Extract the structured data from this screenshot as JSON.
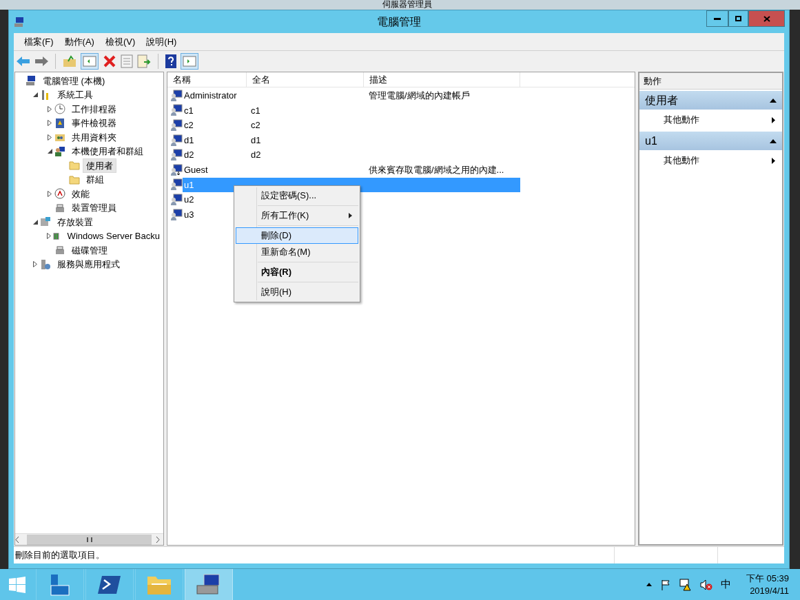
{
  "background_window": {
    "title": "伺服器管理員"
  },
  "window": {
    "title": "電腦管理"
  },
  "menu": [
    {
      "label": "檔案(F)"
    },
    {
      "label": "動作(A)"
    },
    {
      "label": "檢視(V)"
    },
    {
      "label": "說明(H)"
    }
  ],
  "tree": [
    {
      "label": "電腦管理 (本機)",
      "kind": "computer",
      "selected": false,
      "children": [
        {
          "label": "系統工具",
          "kind": "tools",
          "expanded": true,
          "selected": false,
          "children": [
            {
              "label": "工作排程器",
              "kind": "clock",
              "expanded": false,
              "selected": false
            },
            {
              "label": "事件檢視器",
              "kind": "event",
              "expanded": false,
              "selected": false
            },
            {
              "label": "共用資料夾",
              "kind": "share",
              "expanded": false,
              "selected": false
            },
            {
              "label": "本機使用者和群組",
              "kind": "users",
              "expanded": true,
              "selected": false,
              "children": [
                {
                  "label": "使用者",
                  "kind": "folder",
                  "selected": true
                },
                {
                  "label": "群組",
                  "kind": "folder",
                  "selected": false
                }
              ]
            },
            {
              "label": "效能",
              "kind": "gauge",
              "expanded": false,
              "selected": false
            },
            {
              "label": "裝置管理員",
              "kind": "device",
              "selected": false
            }
          ]
        },
        {
          "label": "存放裝置",
          "kind": "storage",
          "expanded": true,
          "selected": false,
          "children": [
            {
              "label": "Windows Server Backu",
              "kind": "backup",
              "expanded": false,
              "selected": false
            },
            {
              "label": "磁碟管理",
              "kind": "device",
              "selected": false
            }
          ]
        },
        {
          "label": "服務與應用程式",
          "kind": "services",
          "expanded": false,
          "selected": false
        }
      ]
    }
  ],
  "list": {
    "columns": [
      "名稱",
      "全名",
      "描述"
    ],
    "rows": [
      {
        "name": "Administrator",
        "description": "管理電腦/網域的內建帳戶",
        "kind": "user",
        "selected": false
      },
      {
        "name": "c1",
        "full_name": "c1",
        "kind": "user",
        "selected": false
      },
      {
        "name": "c2",
        "full_name": "c2",
        "kind": "user",
        "selected": false
      },
      {
        "name": "d1",
        "full_name": "d1",
        "kind": "user",
        "selected": false
      },
      {
        "name": "d2",
        "full_name": "d2",
        "kind": "user",
        "selected": false
      },
      {
        "name": "Guest",
        "description": "供來賓存取電腦/網域之用的內建...",
        "kind": "guest",
        "selected": false
      },
      {
        "name": "u1",
        "kind": "user",
        "selected": true
      },
      {
        "name": "u2",
        "kind": "user",
        "selected": false
      },
      {
        "name": "u3",
        "kind": "user",
        "selected": false
      }
    ]
  },
  "context_menu": [
    {
      "label": "設定密碼(S)...",
      "kind": "item",
      "separator_before": false,
      "bold": false,
      "selected": false
    },
    {
      "label": "所有工作(K)",
      "kind": "submenu",
      "separator_before": true,
      "bold": false,
      "selected": false
    },
    {
      "label": "刪除(D)",
      "kind": "item",
      "separator_before": true,
      "bold": false,
      "selected": true
    },
    {
      "label": "重新命名(M)",
      "kind": "item",
      "separator_before": false,
      "bold": false,
      "selected": false
    },
    {
      "label": "內容(R)",
      "kind": "item",
      "separator_before": true,
      "bold": true,
      "selected": false
    },
    {
      "label": "說明(H)",
      "kind": "item",
      "separator_before": true,
      "bold": false,
      "selected": false
    }
  ],
  "actions": {
    "header": "動作",
    "sections": [
      {
        "title": "使用者",
        "expanded": true,
        "items": [
          {
            "label": "其他動作"
          }
        ]
      },
      {
        "title": "u1",
        "expanded": true,
        "items": [
          {
            "label": "其他動作"
          }
        ]
      }
    ]
  },
  "status_bar": {
    "text": "刪除目前的選取項目。"
  },
  "taskbar": {
    "apps": [
      {
        "kind": "server",
        "selected": false
      },
      {
        "kind": "powershell",
        "selected": false
      },
      {
        "kind": "explorer",
        "selected": false
      },
      {
        "kind": "computer",
        "selected": true
      }
    ],
    "ime": "中",
    "time": "下午 05:39",
    "date": "2019/4/11"
  }
}
